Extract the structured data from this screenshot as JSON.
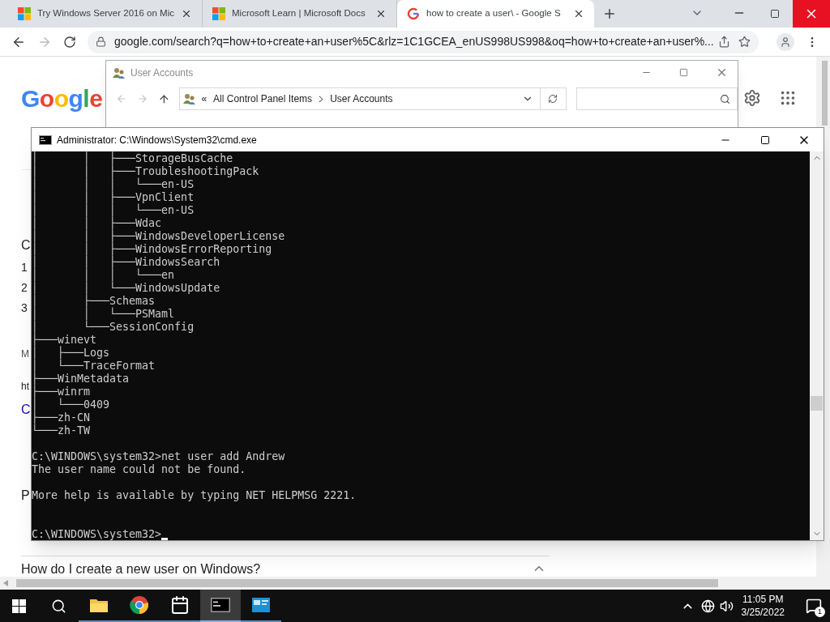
{
  "browser": {
    "tabs": [
      {
        "title": "Try Windows Server 2016 on Mic",
        "kind": "windows",
        "selected": false
      },
      {
        "title": "Microsoft Learn | Microsoft Docs",
        "kind": "windows",
        "selected": false
      },
      {
        "title": "how to create a user\\ - Google S",
        "kind": "google",
        "selected": true
      }
    ],
    "url": "google.com/search?q=how+to+create+an+user%5C&rlz=1C1GCEA_enUS998US998&oq=how+to+create+an+user%..."
  },
  "google_page": {
    "logo": "Google",
    "fragments": [
      {
        "kind": "heading",
        "text": "C"
      },
      {
        "kind": "list",
        "text": "1"
      },
      {
        "kind": "list",
        "text": "2"
      },
      {
        "kind": "list",
        "text": "3"
      },
      {
        "kind": "link",
        "text": "M"
      },
      {
        "kind": "url",
        "text": "ht"
      },
      {
        "kind": "title",
        "text": "C"
      },
      {
        "kind": "heading",
        "text": "P"
      }
    ],
    "faq": {
      "question": "How do I create a new user on Windows?",
      "expanded": true
    }
  },
  "user_accounts_window": {
    "title": "User Accounts",
    "breadcrumb_overflow": "«",
    "breadcrumb": [
      "All Control Panel Items",
      "User Accounts"
    ]
  },
  "cmd_window": {
    "title": "Administrator: C:\\Windows\\System32\\cmd.exe",
    "tree": [
      "│       │   ├───StorageBusCache",
      "│       │   ├───TroubleshootingPack",
      "│       │   │   └───en-US",
      "│       │   ├───VpnClient",
      "│       │   │   └───en-US",
      "│       │   ├───Wdac",
      "│       │   ├───WindowsDeveloperLicense",
      "│       │   ├───WindowsErrorReporting",
      "│       │   ├───WindowsSearch",
      "│       │   │   └───en",
      "│       │   └───WindowsUpdate",
      "│       ├───Schemas",
      "│       │   └───PSMaml",
      "│       └───SessionConfig",
      "├───winevt",
      "│   ├───Logs",
      "│   └───TraceFormat",
      "├───WinMetadata",
      "├───winrm",
      "│   └───0409",
      "├───zh-CN",
      "└───zh-TW"
    ],
    "command": "C:\\WINDOWS\\system32>net user add Andrew",
    "error": "The user name could not be found.",
    "help": "More help is available by typing NET HELPMSG 2221.",
    "prompt": "C:\\WINDOWS\\system32>"
  },
  "taskbar": {
    "apps": [
      {
        "kind": "explorer",
        "active": false
      },
      {
        "kind": "chrome",
        "active": false
      },
      {
        "kind": "calendar",
        "active": false
      },
      {
        "kind": "cmd",
        "active": true
      },
      {
        "kind": "control-panel",
        "active": false
      }
    ],
    "time": "11:05 PM",
    "date": "3/25/2022",
    "notifications": "1"
  }
}
